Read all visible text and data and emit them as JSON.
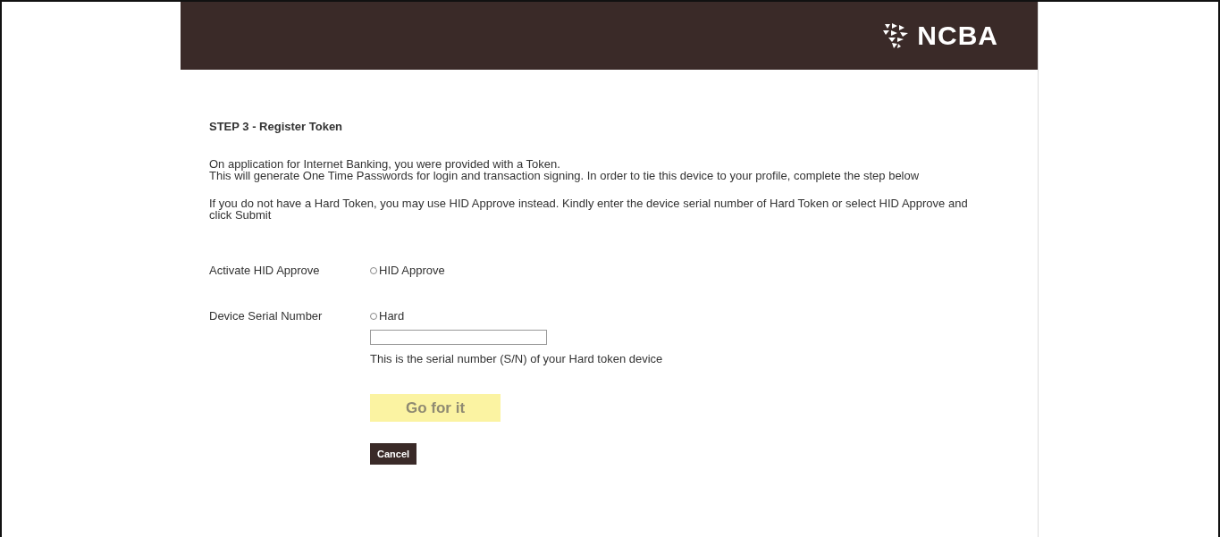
{
  "header": {
    "logo_text": "NCBA"
  },
  "title": "STEP 3 - Register Token",
  "intro": [
    "On application for Internet Banking, you were provided with a Token.",
    "This will generate One Time Passwords for login and transaction signing. In order to tie this device to your profile, complete the step below"
  ],
  "instructions": "If you do not have a Hard Token, you may use HID Approve instead. Kindly enter the device serial number of Hard Token or select HID Approve and click Submit",
  "form": [
    {
      "label": "Activate HID Approve",
      "option": "HID Approve",
      "selected": false
    },
    {
      "label": "Device Serial Number",
      "option": "Hard",
      "selected": false,
      "hint": "This is the serial number (S/N) of your Hard token device"
    }
  ],
  "buttons": [
    {
      "label": "Go for it",
      "kind": "submit",
      "disabled": true
    },
    {
      "label": "Cancel",
      "kind": "cancel",
      "disabled": false
    }
  ]
}
